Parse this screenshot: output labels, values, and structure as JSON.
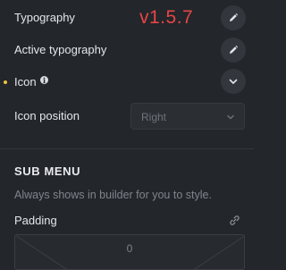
{
  "overlay": {
    "version": "v1.5.7"
  },
  "rows": {
    "typography": {
      "label": "Typography",
      "action_icon": "pencil-icon"
    },
    "active_typography": {
      "label": "Active typography",
      "action_icon": "pencil-icon"
    },
    "icon": {
      "label": "Icon",
      "info_glyph": "i",
      "action_icon": "chevron-down-icon"
    },
    "icon_position": {
      "label": "Icon position",
      "select_value": "Right"
    }
  },
  "sub_menu": {
    "title": "SUB MENU",
    "description": "Always shows in builder for you to style.",
    "padding_label": "Padding",
    "padding_top_value": "0",
    "link_icon": "link-icon"
  },
  "colors": {
    "background": "#23262b",
    "version_text": "#e64545",
    "indicator_dot": "#f0c43a"
  }
}
